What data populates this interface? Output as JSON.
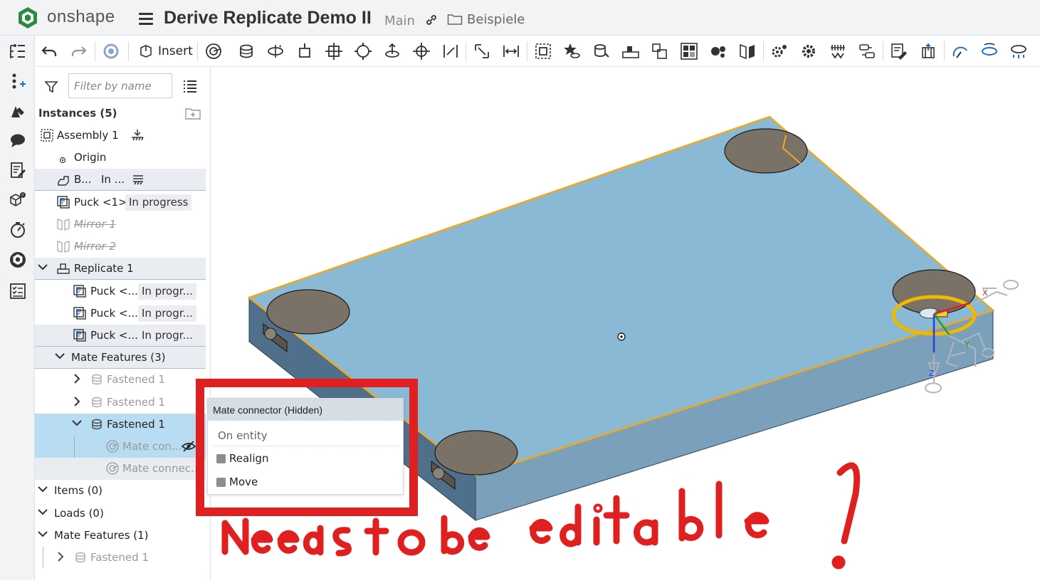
{
  "app": {
    "logo_text": "onshape",
    "document_title": "Derive Replicate Demo II",
    "branch": "Main",
    "folder": "Beispiele"
  },
  "toolbar": {
    "insert_label": "Insert"
  },
  "panel": {
    "filter_placeholder": "Filter by name",
    "instances_header": "Instances (5)",
    "rows": [
      {
        "label": "Assembly 1"
      },
      {
        "label": "Origin"
      },
      {
        "label": "B...",
        "status": "In ..."
      },
      {
        "label": "Puck <1>",
        "status": "In progress"
      },
      {
        "label": "Mirror 1"
      },
      {
        "label": "Mirror 2"
      },
      {
        "label": "Replicate 1"
      },
      {
        "label": "Puck <...",
        "status": "In progr..."
      },
      {
        "label": "Puck <...",
        "status": "In progr..."
      },
      {
        "label": "Puck <...",
        "status": "In progr..."
      },
      {
        "label": "Mate Features (3)"
      },
      {
        "label": "Fastened 1"
      },
      {
        "label": "Fastened 1"
      },
      {
        "label": "Fastened 1"
      },
      {
        "label": "Mate con..."
      },
      {
        "label": "Mate connec..."
      },
      {
        "label": "Items (0)"
      },
      {
        "label": "Loads (0)"
      },
      {
        "label": "Mate Features (1)"
      },
      {
        "label": "Fastened 1"
      }
    ]
  },
  "context_menu": {
    "title": "Mate connector (Hidden)",
    "entity_label": "On entity",
    "items": [
      {
        "label": "Realign"
      },
      {
        "label": "Move"
      }
    ]
  },
  "annotation": {
    "handwritten_text": "Needs to be editable !",
    "color": "#e02020"
  },
  "colors": {
    "part_face": "#8ab9d6",
    "part_side": "#4f6f8a",
    "part_front": "#7aa0bb",
    "selection_orange": "#f0a81e",
    "hole_fill": "#7a7266"
  }
}
